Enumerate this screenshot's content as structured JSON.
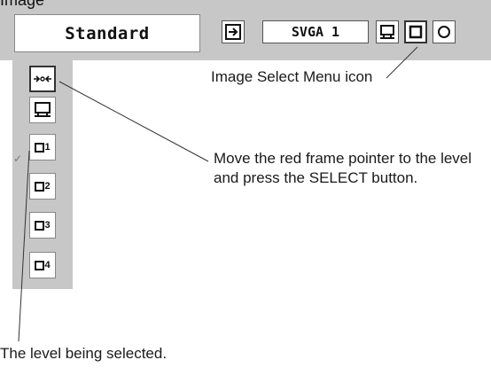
{
  "header": {
    "cut_caption": "Image",
    "mode_label": "Standard",
    "source_label": "SVGA 1"
  },
  "sidebar": {
    "items": [
      {
        "icon": "fit-arrows-icon"
      },
      {
        "icon": "monitor-icon"
      },
      {
        "icon": "image-level-icon",
        "level": "1"
      },
      {
        "icon": "image-level-icon",
        "level": "2"
      },
      {
        "icon": "image-level-icon",
        "level": "3"
      },
      {
        "icon": "image-level-icon",
        "level": "4"
      }
    ],
    "selected_mark": "✓"
  },
  "notes": {
    "image_select": "Image Select Menu icon",
    "instruction": "Move the red frame pointer to the level and press the SELECT button.",
    "level_selected": "The level being selected."
  }
}
